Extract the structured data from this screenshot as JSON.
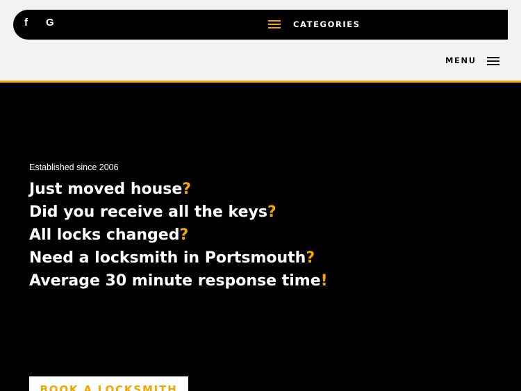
{
  "header": {
    "social": [
      {
        "label": "f",
        "icon": "facebook-icon"
      },
      {
        "label": "G",
        "icon": "google-icon"
      }
    ],
    "categories_label": "CATEGORIES",
    "menu_label": "MENU"
  },
  "hero": {
    "established": "Established since 2006",
    "lines": [
      {
        "text": "Just moved house",
        "mark": "?"
      },
      {
        "text": "Did you receive all the keys",
        "mark": "?"
      },
      {
        "text": "All locks changed",
        "mark": "?"
      },
      {
        "text": "Need a locksmith in Portsmouth",
        "mark": "?"
      },
      {
        "text": "Average 30 minute response time",
        "mark": "!"
      }
    ],
    "cta_label": "BOOK A LOCKSMITH"
  },
  "colors": {
    "accent": "#f3a500",
    "dark": "#000000",
    "light": "#f2f2f0"
  }
}
